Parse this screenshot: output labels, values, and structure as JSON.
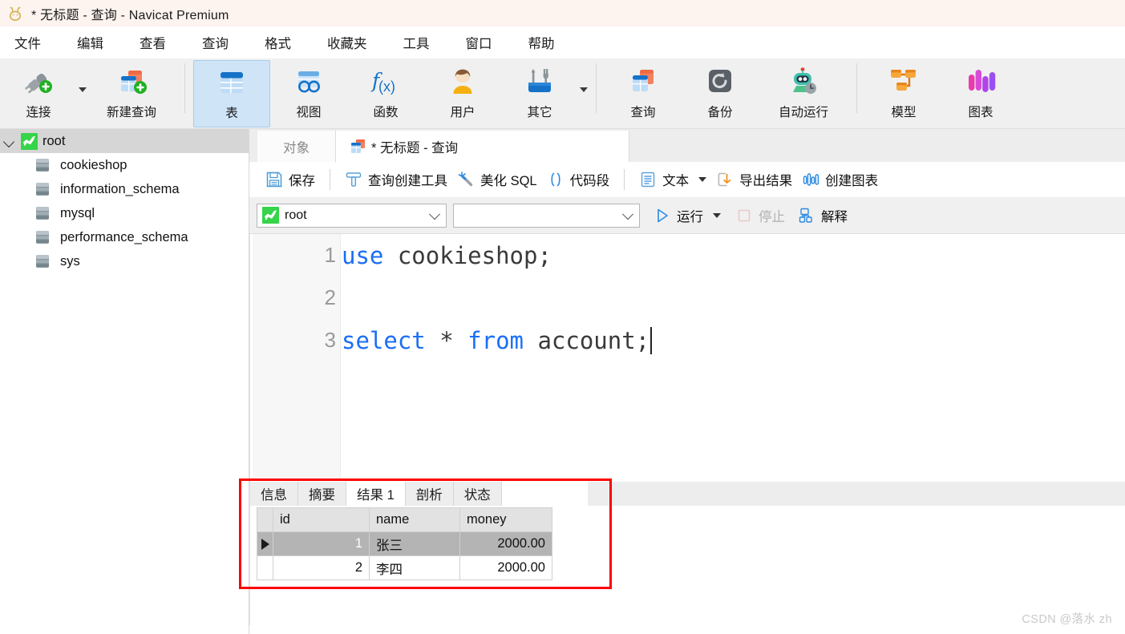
{
  "window": {
    "title": "* 无标题 - 查询 - Navicat Premium",
    "logo_icon": "navicat-rabbit-logo"
  },
  "menubar": {
    "items": [
      {
        "label": "文件"
      },
      {
        "label": "编辑"
      },
      {
        "label": "查看"
      },
      {
        "label": "查询"
      },
      {
        "label": "格式"
      },
      {
        "label": "收藏夹"
      },
      {
        "label": "工具"
      },
      {
        "label": "窗口"
      },
      {
        "label": "帮助"
      }
    ]
  },
  "ribbon": {
    "buttons": [
      {
        "label": "连接",
        "icon": "connection-plug-plus-icon",
        "has_caret": true,
        "active": false
      },
      {
        "label": "新建查询",
        "icon": "new-query-plus-icon",
        "has_caret": false,
        "active": false
      },
      {
        "label": "表",
        "icon": "table-icon",
        "has_caret": false,
        "active": true
      },
      {
        "label": "视图",
        "icon": "view-glasses-icon",
        "has_caret": false,
        "active": false
      },
      {
        "label": "函数",
        "icon": "function-fx-icon",
        "has_caret": false,
        "active": false
      },
      {
        "label": "用户",
        "icon": "user-icon",
        "has_caret": false,
        "active": false
      },
      {
        "label": "其它",
        "icon": "other-tools-icon",
        "has_caret": true,
        "active": false
      },
      {
        "label": "查询",
        "icon": "query-icon",
        "has_caret": false,
        "active": false
      },
      {
        "label": "备份",
        "icon": "backup-restore-icon",
        "has_caret": false,
        "active": false
      },
      {
        "label": "自动运行",
        "icon": "automation-robot-icon",
        "has_caret": false,
        "active": false
      },
      {
        "label": "模型",
        "icon": "model-diagram-icon",
        "has_caret": false,
        "active": false
      },
      {
        "label": "图表",
        "icon": "chart-bars-icon",
        "has_caret": false,
        "active": false
      }
    ]
  },
  "sidebar": {
    "root": {
      "label": "root",
      "icon": "mysql-dolphin-icon",
      "expanded": true
    },
    "databases": [
      {
        "label": "cookieshop",
        "icon": "database-icon"
      },
      {
        "label": "information_schema",
        "icon": "database-icon"
      },
      {
        "label": "mysql",
        "icon": "database-icon"
      },
      {
        "label": "performance_schema",
        "icon": "database-icon"
      },
      {
        "label": "sys",
        "icon": "database-icon"
      }
    ]
  },
  "tabs": {
    "object_tab": {
      "label": "对象",
      "active": false
    },
    "query_tab": {
      "label": "* 无标题 - 查询",
      "active": true,
      "icon": "query-tab-icon"
    }
  },
  "query_toolbar": {
    "save": {
      "label": "保存",
      "icon": "save-floppy-icon"
    },
    "query_builder": {
      "label": "查询创建工具",
      "icon": "query-builder-icon"
    },
    "beautify_sql": {
      "label": "美化 SQL",
      "icon": "magic-wand-icon"
    },
    "snippet": {
      "label": "代码段",
      "icon": "parentheses-icon"
    },
    "text": {
      "label": "文本",
      "icon": "text-document-icon",
      "has_caret": true
    },
    "export_result": {
      "label": "导出结果",
      "icon": "export-arrow-icon"
    },
    "create_chart": {
      "label": "创建图表",
      "icon": "chart-bars-small-icon"
    }
  },
  "connection_bar": {
    "connection": {
      "value": "root",
      "icon": "mysql-dolphin-icon"
    },
    "database": {
      "value": "",
      "placeholder": ""
    },
    "run": {
      "label": "运行",
      "icon": "play-triangle-icon",
      "has_caret": true,
      "enabled": true
    },
    "stop": {
      "label": "停止",
      "icon": "stop-square-icon",
      "enabled": false
    },
    "explain": {
      "label": "解释",
      "icon": "explain-plan-icon",
      "enabled": true
    }
  },
  "editor": {
    "lines": [
      {
        "no": "1",
        "tokens": [
          {
            "t": "use",
            "k": "kw"
          },
          {
            "t": " cookieshop;",
            "k": "pl"
          }
        ]
      },
      {
        "no": "2",
        "tokens": []
      },
      {
        "no": "3",
        "tokens": [
          {
            "t": "select",
            "k": "kw"
          },
          {
            "t": " * ",
            "k": "pl"
          },
          {
            "t": "from",
            "k": "kw"
          },
          {
            "t": " account;",
            "k": "pl"
          }
        ]
      }
    ],
    "full_text": "use cookieshop;\n\nselect * from account;"
  },
  "results": {
    "tabs": [
      {
        "label": "信息",
        "active": false
      },
      {
        "label": "摘要",
        "active": false
      },
      {
        "label": "结果 1",
        "active": true
      },
      {
        "label": "剖析",
        "active": false
      },
      {
        "label": "状态",
        "active": false
      }
    ],
    "grid": {
      "columns": [
        "id",
        "name",
        "money"
      ],
      "rows": [
        {
          "selected": true,
          "cells": [
            "1",
            "张三",
            "2000.00"
          ]
        },
        {
          "selected": false,
          "cells": [
            "2",
            "李四",
            "2000.00"
          ]
        }
      ]
    }
  },
  "annotation": {
    "highlight_color": "#fe0000"
  },
  "watermark": {
    "text": "CSDN @落水 zh"
  }
}
